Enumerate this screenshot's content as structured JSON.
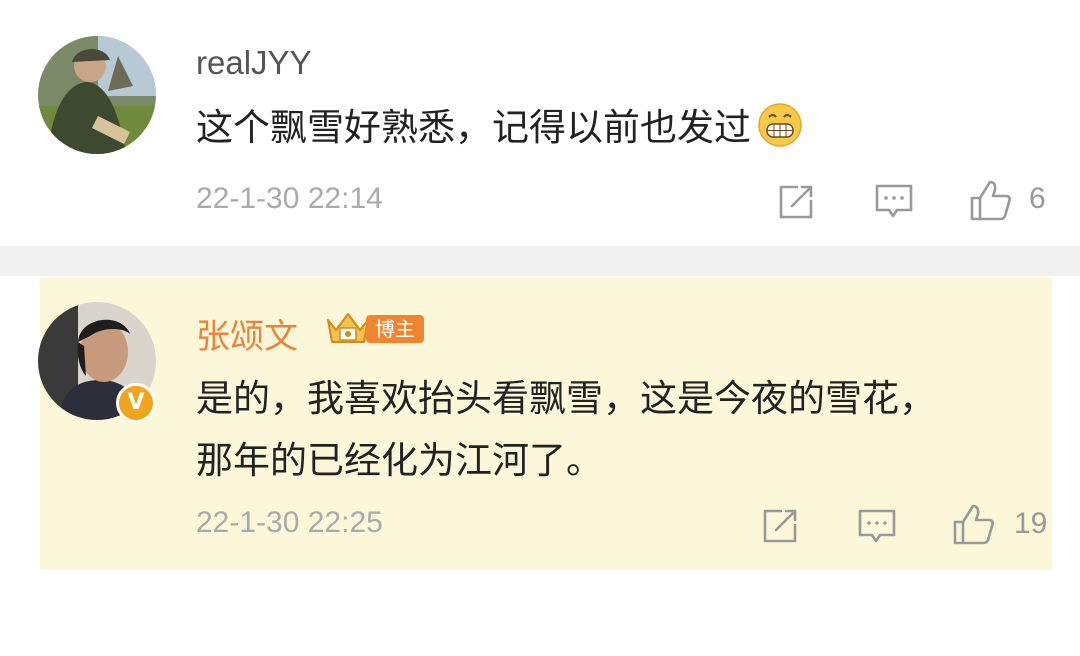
{
  "comments": [
    {
      "username": "realJYY",
      "text": "这个飘雪好熟悉，记得以前也发过",
      "emoji": "grinning-face-emoji",
      "time": "22-1-30 22:14",
      "likes": "6"
    },
    {
      "username": "张颂文",
      "badge": "博主",
      "verified": "V",
      "text_line1": "是的，我喜欢抬头看飘雪，这是今夜的雪花，",
      "text_line2": "那年的已经化为江河了。",
      "time": "22-1-30 22:25",
      "likes": "19"
    }
  ],
  "icons": {
    "share": "share-icon",
    "comment": "comment-icon",
    "like": "like-icon"
  },
  "colors": {
    "author_name": "#e8853d",
    "highlight_bg": "#fcf7d9",
    "badge_bg": "#f0842f",
    "verified_bg": "#f0a51e"
  }
}
